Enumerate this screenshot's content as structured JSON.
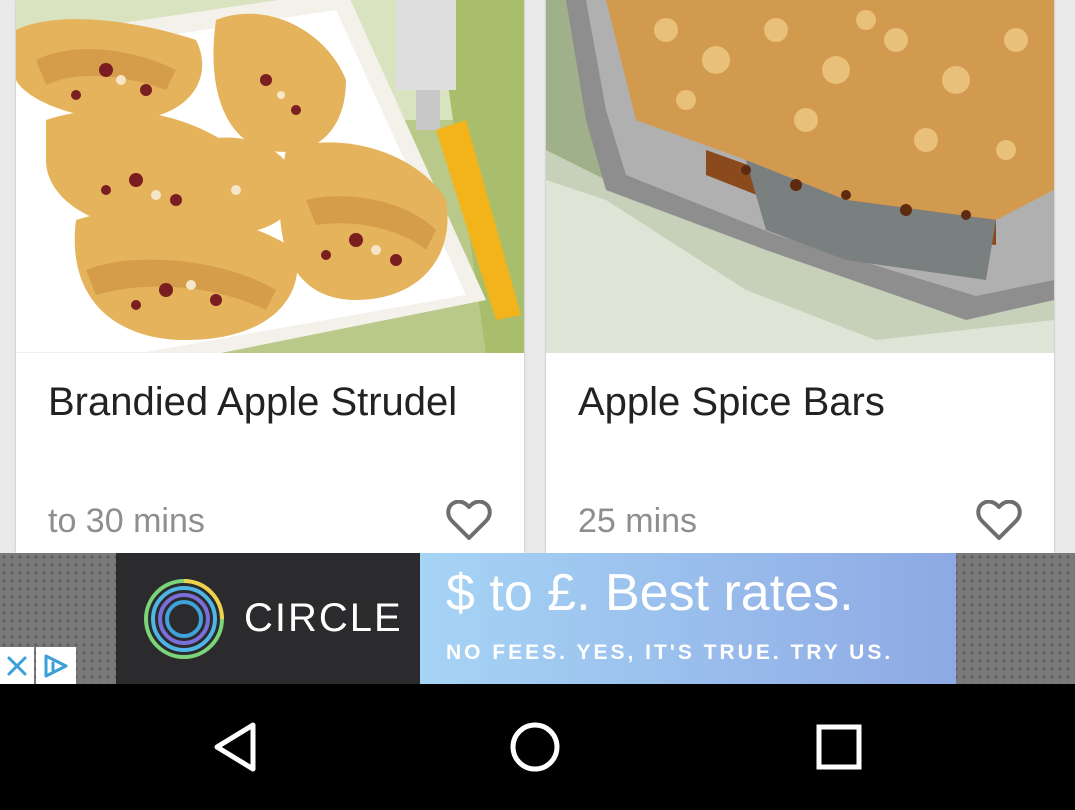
{
  "cards": [
    {
      "title": "Brandied Apple Strudel",
      "time": "to 30 mins",
      "favorite_icon": "heart-outline-icon",
      "image": "apple-strudel-photo"
    },
    {
      "title": "Apple Spice Bars",
      "time": "25 mins",
      "favorite_icon": "heart-outline-icon",
      "image": "apple-spice-bars-photo"
    }
  ],
  "ad": {
    "brand": "CIRCLE",
    "headline": "$ to £. Best rates.",
    "subline": "NO FEES. YES, IT'S TRUE. TRY US.",
    "close_icon": "close-icon",
    "choices_icon": "adchoices-icon"
  },
  "navbar": {
    "back_icon": "back-icon",
    "home_icon": "home-icon",
    "recents_icon": "recents-icon"
  },
  "colors": {
    "card_bg": "#ffffff",
    "title": "#222222",
    "meta": "#8e8e8e",
    "ad_brand_bg": "#2b2b2d",
    "ad_copy_start": "#a6d4f5",
    "ad_copy_end": "#8ea9e4",
    "nav_bg": "#000000"
  }
}
